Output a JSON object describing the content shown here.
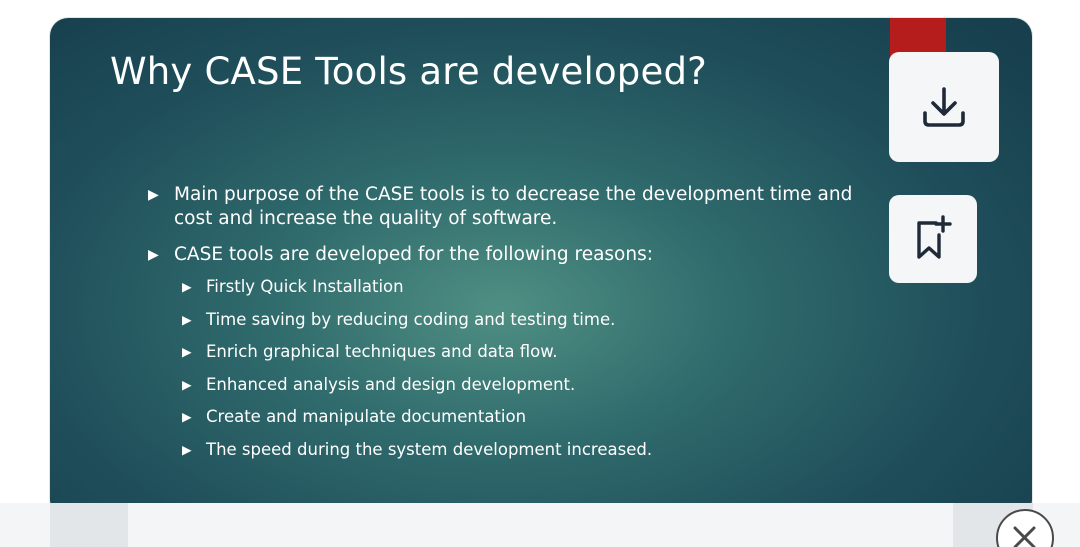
{
  "slide": {
    "title": "Why CASE Tools are developed?",
    "bullets": [
      {
        "text": "Main purpose of the CASE tools is to decrease the development time and cost and increase the quality of software."
      },
      {
        "text": "CASE tools are developed for the following reasons:",
        "sub_items": [
          "Firstly Quick Installation",
          "Time saving by reducing coding and testing time.",
          "Enrich graphical techniques and data flow.",
          "Enhanced analysis and design development.",
          "Create and manipulate documentation",
          "The speed during the system development increased."
        ]
      }
    ],
    "bullet_glyph": "▶"
  },
  "actions": {
    "download_icon": "download-icon",
    "bookmark_icon": "bookmark-add-icon",
    "close_icon": "close-icon"
  },
  "colors": {
    "slide_bg_center": "#4f8f83",
    "slide_bg_edge": "#173f4d",
    "accent_red": "#b51c1c",
    "icon_stroke": "#1e2a38"
  }
}
